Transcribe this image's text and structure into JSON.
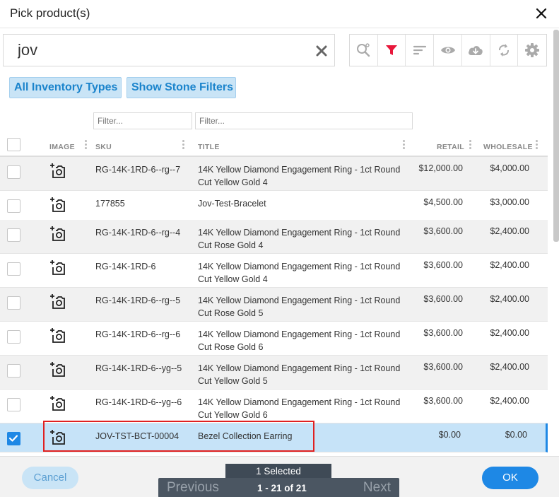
{
  "dialog": {
    "title": "Pick product(s)"
  },
  "search": {
    "value": "jov"
  },
  "chips": {
    "inventory_types": "All Inventory Types",
    "stone_filters": "Show Stone Filters"
  },
  "filters": {
    "sku_placeholder": "Filter...",
    "title_placeholder": "Filter..."
  },
  "columns": {
    "image": "IMAGE",
    "sku": "SKU",
    "title": "TITLE",
    "retail": "RETAIL",
    "wholesale": "WHOLESALE"
  },
  "rows": [
    {
      "sku": "RG-14K-1RD-6--rg--7",
      "title": "14K Yellow Diamond Engagement Ring - 1ct Round Cut Yellow Gold 4",
      "retail": "$12,000.00",
      "wholesale": "$4,000.00",
      "checked": false
    },
    {
      "sku": "177855",
      "title": "Jov-Test-Bracelet",
      "retail": "$4,500.00",
      "wholesale": "$3,000.00",
      "checked": false
    },
    {
      "sku": "RG-14K-1RD-6--rg--4",
      "title": "14K Yellow Diamond Engagement Ring - 1ct Round Cut Rose Gold 4",
      "retail": "$3,600.00",
      "wholesale": "$2,400.00",
      "checked": false
    },
    {
      "sku": "RG-14K-1RD-6",
      "title": "14K Yellow Diamond Engagement Ring - 1ct Round Cut Yellow Gold 4",
      "retail": "$3,600.00",
      "wholesale": "$2,400.00",
      "checked": false
    },
    {
      "sku": "RG-14K-1RD-6--rg--5",
      "title": "14K Yellow Diamond Engagement Ring - 1ct Round Cut Rose Gold 5",
      "retail": "$3,600.00",
      "wholesale": "$2,400.00",
      "checked": false
    },
    {
      "sku": "RG-14K-1RD-6--rg--6",
      "title": "14K Yellow Diamond Engagement Ring - 1ct Round Cut Rose Gold 6",
      "retail": "$3,600.00",
      "wholesale": "$2,400.00",
      "checked": false
    },
    {
      "sku": "RG-14K-1RD-6--yg--5",
      "title": "14K Yellow Diamond Engagement Ring - 1ct Round Cut Yellow Gold 5",
      "retail": "$3,600.00",
      "wholesale": "$2,400.00",
      "checked": false
    },
    {
      "sku": "RG-14K-1RD-6--yg--6",
      "title": "14K Yellow Diamond Engagement Ring - 1ct Round Cut Yellow Gold 6",
      "retail": "$3,600.00",
      "wholesale": "$2,400.00",
      "checked": false
    },
    {
      "sku": "JOV-TST-BCT-00004",
      "title": "Bezel Collection Earring",
      "retail": "$0.00",
      "wholesale": "$0.00",
      "checked": true
    }
  ],
  "footer": {
    "cancel": "Cancel",
    "ok": "OK",
    "selected": "1 Selected",
    "previous": "Previous",
    "range": "1 - 21 of 21",
    "next": "Next"
  },
  "icons": {
    "close": "close-icon",
    "clear": "clear-search-icon",
    "toolbar": [
      "search-settings-icon",
      "filter-icon",
      "sort-icon",
      "eye-icon",
      "cloud-download-icon",
      "refresh-icon",
      "gear-icon"
    ],
    "image": "add-photo-icon"
  },
  "colors": {
    "accent": "#1e88e5",
    "filter_active": "#e8173b",
    "chip_bg": "#c9e4f6",
    "selected_row": "#c6e3f8",
    "highlight": "#e02020"
  }
}
